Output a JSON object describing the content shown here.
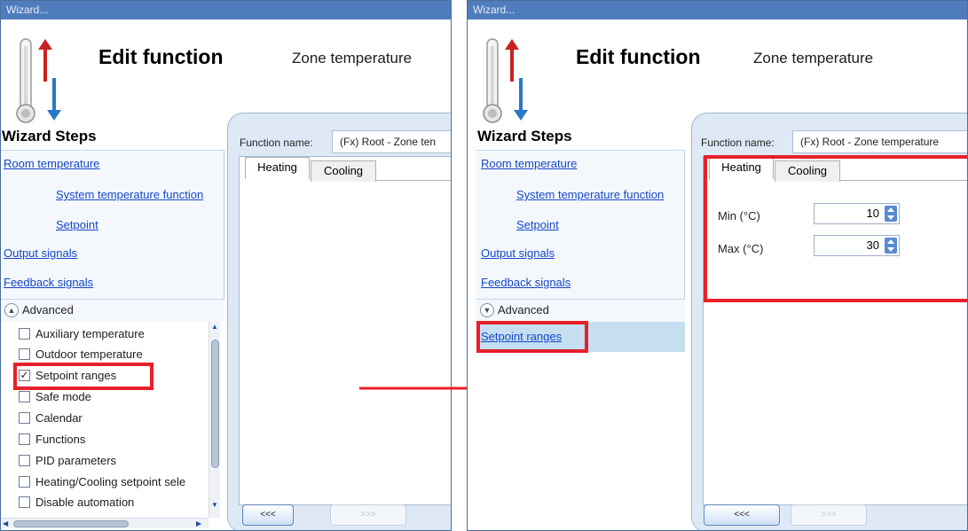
{
  "accent_colors": {
    "titlebar": "#4f7cbd",
    "link": "#1546c7",
    "highlight": "#e8202a",
    "selected_row": "#c5dff0"
  },
  "left": {
    "window_title": "Wizard...",
    "header_title": "Edit function",
    "header_subtitle": "Zone temperature",
    "steps_title": "Wizard Steps",
    "steps": [
      "Room temperature",
      "System temperature function",
      "Setpoint",
      "Output signals",
      "Feedback signals"
    ],
    "advanced_label": "Advanced",
    "advanced_items": [
      {
        "label": "Auxiliary temperature",
        "checked": false
      },
      {
        "label": "Outdoor temperature",
        "checked": false
      },
      {
        "label": "Setpoint ranges",
        "checked": true
      },
      {
        "label": "Safe mode",
        "checked": false
      },
      {
        "label": "Calendar",
        "checked": false
      },
      {
        "label": "Functions",
        "checked": false
      },
      {
        "label": "PID parameters",
        "checked": false
      },
      {
        "label": "Heating/Cooling setpoint sele",
        "checked": false
      },
      {
        "label": "Disable automation",
        "checked": false
      }
    ],
    "function_name_label": "Function name:",
    "function_name_value": "(Fx) Root - Zone ten",
    "tabs": [
      "Heating",
      "Cooling"
    ],
    "back_button": "<<<",
    "next_button": ">>>"
  },
  "right": {
    "window_title": "Wizard...",
    "header_title": "Edit function",
    "header_subtitle": "Zone temperature",
    "steps_title": "Wizard Steps",
    "steps": [
      "Room temperature",
      "System temperature function",
      "Setpoint",
      "Output signals",
      "Feedback signals"
    ],
    "advanced_label": "Advanced",
    "advanced_selected": "Setpoint ranges",
    "function_name_label": "Function name:",
    "function_name_value": "(Fx) Root - Zone temperature",
    "tabs": [
      "Heating",
      "Cooling"
    ],
    "min_label": "Min (°C)",
    "min_value": "10",
    "max_label": "Max (°C)",
    "max_value": "30",
    "back_button": "<<<",
    "next_button": ">>>"
  }
}
